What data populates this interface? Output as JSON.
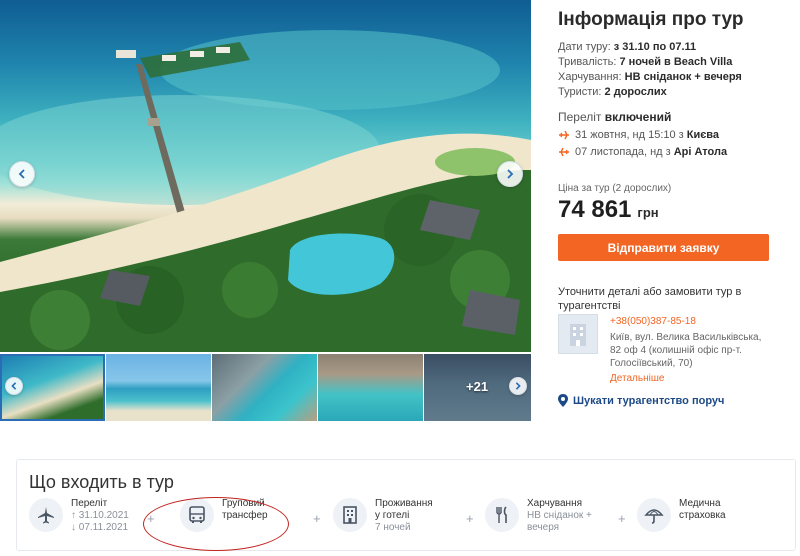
{
  "gallery": {
    "more_count": "+21"
  },
  "info": {
    "title": "Інформація про тур",
    "dates_label": "Дати туру:",
    "dates_value": "з 31.10 по 07.11",
    "duration_label": "Тривалість:",
    "duration_value": "7 ночей в Beach Villa",
    "meals_label": "Харчування:",
    "meals_value": "HB сніданок + вечеря",
    "tourists_label": "Туристи:",
    "tourists_value": "2 дорослих",
    "flight_label": "Переліт",
    "flight_status": "включений",
    "flight_out": "31 жовтня, нд 15:10 з",
    "flight_out_city": "Києва",
    "flight_back": "07 листопада, нд з",
    "flight_back_city": "Арі Атола",
    "price_label": "Ціна за тур (2 дорослих)",
    "price_value": "74 861",
    "price_currency": "грн",
    "order_button": "Відправити заявку",
    "agency_hint": "Уточнити деталі або замовити тур в турагентстві",
    "agency_phone": "+38(050)387-85-18",
    "agency_address": "Київ, вул. Велика Васильківська, 82 оф 4 (колишній офіс пр-т. Голосіївський, 70)",
    "agency_more": "Детальніше",
    "find_agency": "Шукати турагентство поруч"
  },
  "included": {
    "title": "Що входить в тур",
    "items": [
      {
        "name": "Переліт",
        "sub1": "↑ 31.10.2021",
        "sub2": "↓ 07.11.2021",
        "icon": "plane-icon"
      },
      {
        "name": "Груповий",
        "name2": "трансфер",
        "icon": "bus-icon"
      },
      {
        "name": "Проживання",
        "name2": "у готелі",
        "sub1": "7 ночей",
        "icon": "hotel-icon"
      },
      {
        "name": "Харчування",
        "sub1": "HB сніданок +",
        "sub2": "вечеря",
        "icon": "cutlery-icon"
      },
      {
        "name": "Медична",
        "name2": "страховка",
        "icon": "umbrella-icon"
      }
    ],
    "plus": "+"
  },
  "colors": {
    "accent": "#f26522",
    "link": "#1d4a86",
    "nav": "#2a6db5",
    "highlight": "#c0241f"
  }
}
